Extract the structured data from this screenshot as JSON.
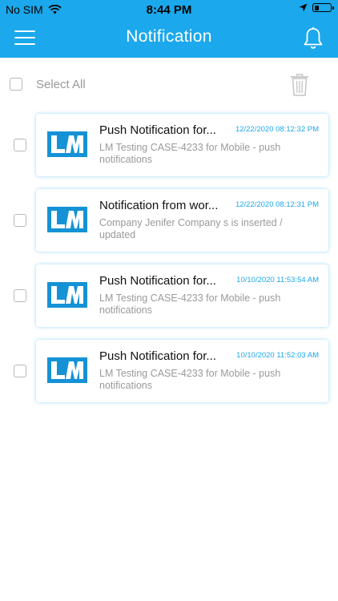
{
  "status_bar": {
    "carrier": "No SIM",
    "time": "8:44 PM"
  },
  "header": {
    "title": "Notification"
  },
  "select_all": {
    "label": "Select All"
  },
  "colors": {
    "accent": "#1ba8ec",
    "muted_text": "#9a9a9a",
    "logo_blue": "#1592d6"
  },
  "logo_text": "LM",
  "notifications": [
    {
      "title": "Push Notification for...",
      "time": "12/22/2020 08:12:32 PM",
      "body": "LM Testing CASE-4233 for Mobile - push notifications"
    },
    {
      "title": "Notification from wor...",
      "time": "12/22/2020 08:12:31 PM",
      "body": "Company Jenifer Company s is inserted / updated"
    },
    {
      "title": "Push Notification for...",
      "time": "10/10/2020 11:53:54 AM",
      "body": "LM Testing CASE-4233 for Mobile - push notifications"
    },
    {
      "title": "Push Notification for...",
      "time": "10/10/2020 11:52:03 AM",
      "body": "LM Testing CASE-4233 for Mobile - push notifications"
    }
  ],
  "icons": [
    "wifi-icon",
    "location-arrow-icon",
    "battery-icon",
    "hamburger-menu-icon",
    "bell-icon",
    "trash-icon",
    "lm-logo-icon"
  ]
}
